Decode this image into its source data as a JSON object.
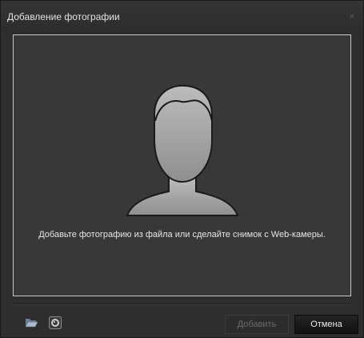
{
  "dialog": {
    "title": "Добавление фотографии",
    "close_glyph": "×"
  },
  "main": {
    "hint": "Добавьте фотографию из файла или сделайте снимок с Web-камеры."
  },
  "toolbar": {
    "folder_icon": "folder-open-icon",
    "camera_icon": "webcam-icon"
  },
  "footer": {
    "add_label": "Добавить",
    "cancel_label": "Отмена"
  },
  "colors": {
    "background": "#2e2e2e",
    "panel": "#383838",
    "panel_border": "#c9c9c9",
    "silhouette_fill": "#a4a4a4",
    "disabled_text": "#6a6a6a"
  }
}
